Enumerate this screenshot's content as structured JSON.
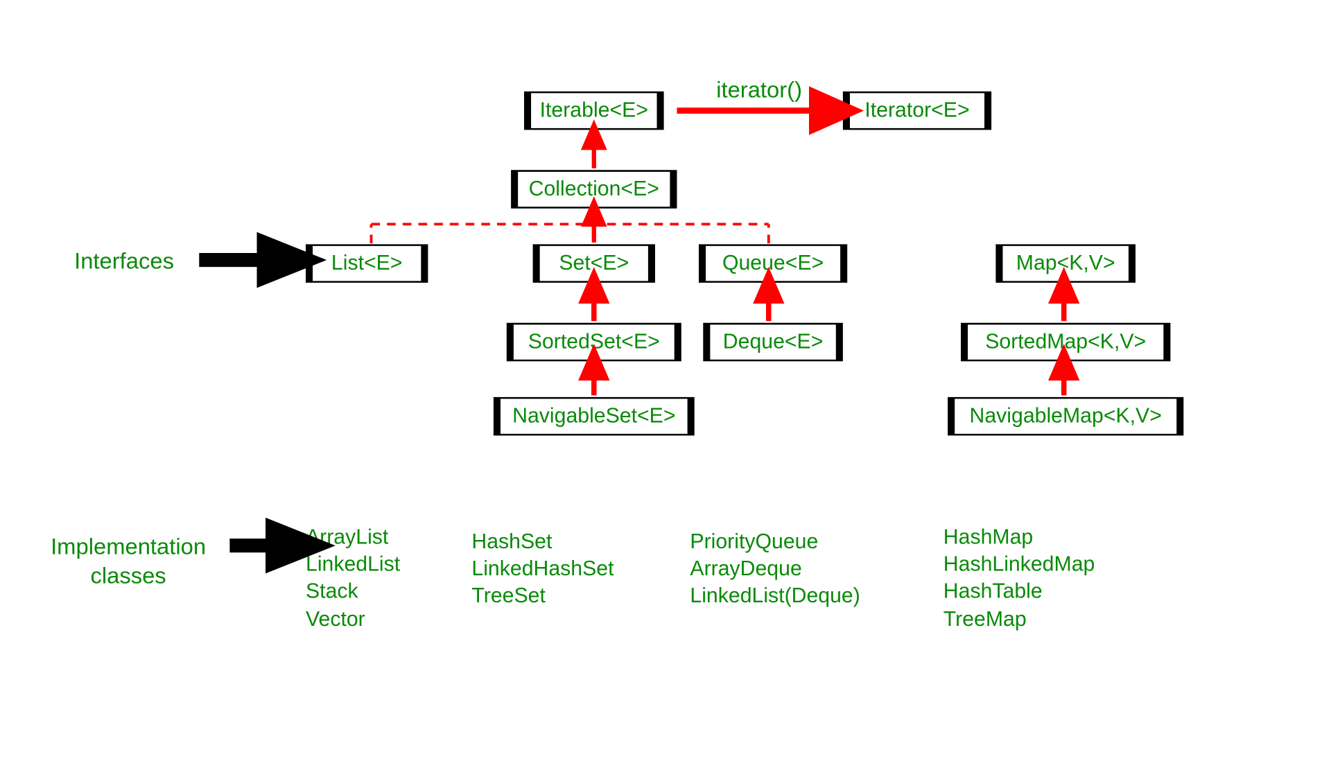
{
  "labels": {
    "interfaces": "Interfaces",
    "implementation1": "Implementation",
    "implementation2": "classes",
    "iterator_method": "iterator()"
  },
  "boxes": {
    "iterable": "Iterable<E>",
    "iterator": "Iterator<E>",
    "collection": "Collection<E>",
    "list": "List<E>",
    "set": "Set<E>",
    "queue": "Queue<E>",
    "sortedset": "SortedSet<E>",
    "deque": "Deque<E>",
    "navigableset": "NavigableSet<E>",
    "map": "Map<K,V>",
    "sortedmap": "SortedMap<K,V>",
    "navigablemap": "NavigableMap<K,V>"
  },
  "impl": {
    "list": [
      "ArrayList",
      "LinkedList",
      "Stack",
      "Vector"
    ],
    "set": [
      "HashSet",
      "LinkedHashSet",
      "TreeSet"
    ],
    "queue": [
      "PriorityQueue",
      "ArrayDeque",
      "LinkedList(Deque)"
    ],
    "map": [
      "HashMap",
      "HashLinkedMap",
      "HashTable",
      "TreeMap"
    ]
  },
  "colors": {
    "text": "#0a8a0a",
    "arrow_red": "#ff0000",
    "arrow_black": "#000000"
  }
}
